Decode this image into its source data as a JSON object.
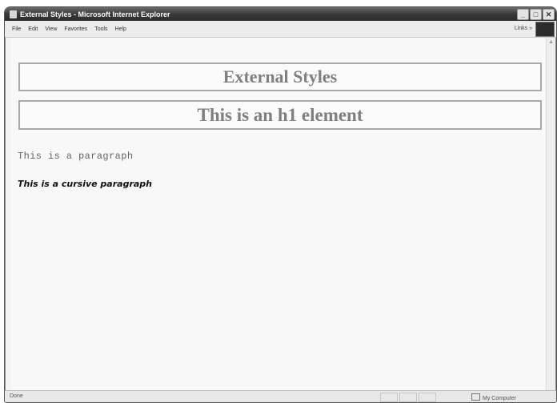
{
  "window": {
    "title": "External Styles - Microsoft Internet Explorer",
    "controls": {
      "minimize": "_",
      "maximize": "□",
      "close": "✕"
    }
  },
  "menu": {
    "items": [
      "File",
      "Edit",
      "View",
      "Favorites",
      "Tools",
      "Help"
    ],
    "links_label": "Links »"
  },
  "page": {
    "heading_box": "External Styles",
    "h1": "This is an h1 element",
    "paragraph": "This is a paragraph",
    "cursive_paragraph": "This is a cursive paragraph"
  },
  "status": {
    "left": "Done",
    "zone": "My Computer"
  },
  "icons": {
    "window_icon": "ie-page-icon",
    "zone_icon": "computer-icon",
    "status_icon": "page-done-icon"
  }
}
